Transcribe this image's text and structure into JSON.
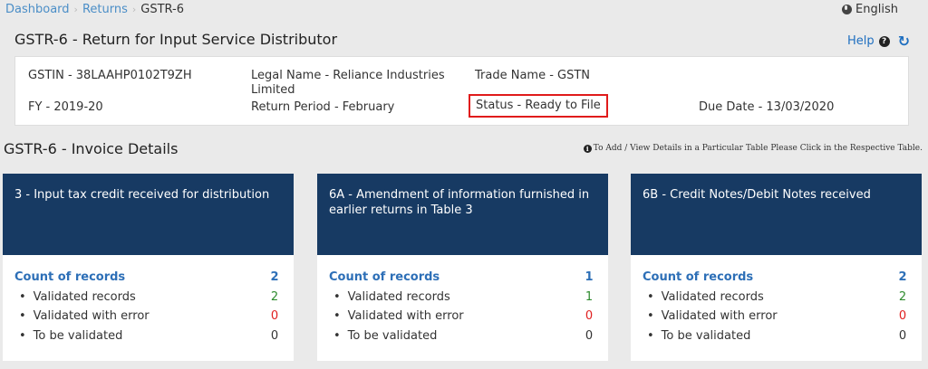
{
  "breadcrumb": {
    "items": [
      "Dashboard",
      "Returns"
    ],
    "current": "GSTR-6",
    "separator": "›"
  },
  "language": {
    "label": "English",
    "icon": "globe-icon"
  },
  "header": {
    "title": "GSTR-6 - Return for Input Service Distributor",
    "help_label": "Help",
    "help_icon": "question-circle-icon",
    "refresh_icon": "refresh-icon"
  },
  "info": {
    "gstin": "GSTIN - 38LAAHP0102T9ZH",
    "legal_name": "Legal Name - Reliance Industries Limited",
    "trade_name": "Trade Name - GSTN",
    "fy": "FY - 2019-20",
    "return_period": "Return Period - February",
    "status": "Status - Ready to File",
    "due_date": "Due Date - 13/03/2020"
  },
  "section": {
    "title": "GSTR-6 - Invoice Details",
    "hint": "To Add / View Details in a Particular Table Please Click in the Respective Table.",
    "hint_icon": "info-icon"
  },
  "tiles": [
    {
      "title": "3 - Input tax credit received for distribution",
      "count_label": "Count of records",
      "count": "2",
      "validated_label": "Validated records",
      "validated": "2",
      "error_label": "Validated with error",
      "error": "0",
      "pending_label": "To be validated",
      "pending": "0"
    },
    {
      "title": "6A - Amendment of information furnished in earlier returns in Table 3",
      "count_label": "Count of records",
      "count": "1",
      "validated_label": "Validated records",
      "validated": "1",
      "error_label": "Validated with error",
      "error": "0",
      "pending_label": "To be validated",
      "pending": "0"
    },
    {
      "title": "6B - Credit Notes/Debit Notes received",
      "count_label": "Count of records",
      "count": "2",
      "validated_label": "Validated records",
      "validated": "2",
      "error_label": "Validated with error",
      "error": "0",
      "pending_label": "To be validated",
      "pending": "0"
    }
  ],
  "colors": {
    "tile_header": "#173a63",
    "link": "#4b8ec7",
    "count": "#2d6fb7",
    "validated": "#2e8b2e",
    "error": "#e02020",
    "status_border": "#e01b1b"
  }
}
